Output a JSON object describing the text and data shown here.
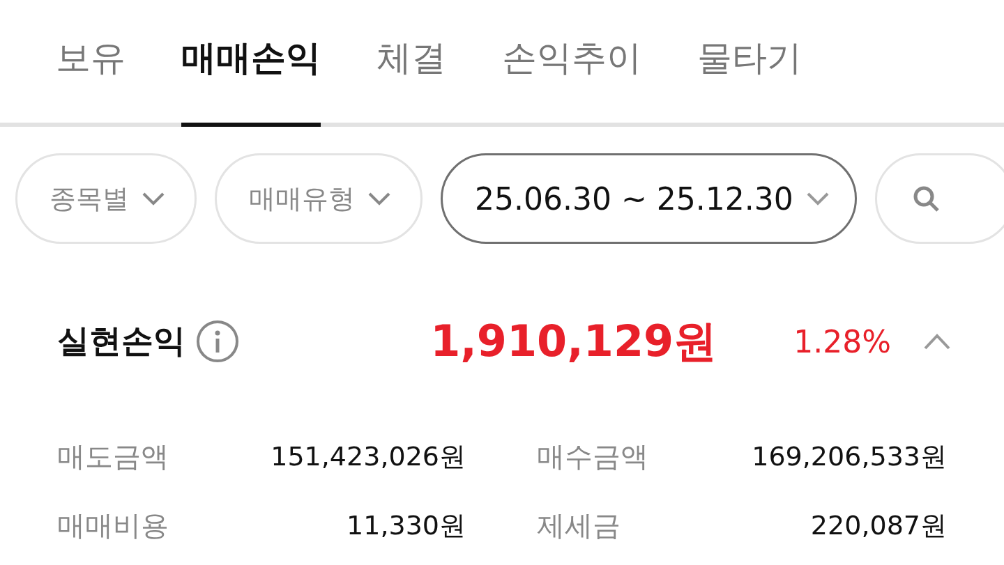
{
  "tabs": [
    {
      "label": "보유",
      "selected": false
    },
    {
      "label": "매매손익",
      "selected": true
    },
    {
      "label": "체결",
      "selected": false
    },
    {
      "label": "손익추이",
      "selected": false
    },
    {
      "label": "물타기",
      "selected": false
    }
  ],
  "filters": [
    {
      "kind": "dropdown",
      "label": "종목별",
      "active": false
    },
    {
      "kind": "dropdown",
      "label": "매매유형",
      "active": false
    },
    {
      "kind": "dropdown",
      "label": "25.06.30 ~ 25.12.30",
      "active": true
    },
    {
      "kind": "search",
      "active": false
    }
  ],
  "summary": {
    "label": "실현손익",
    "amount": "1,910,129원",
    "rate": "1.28%",
    "expanded": true
  },
  "details": [
    {
      "label": "매도금액",
      "value": "151,423,026원"
    },
    {
      "label": "매수금액",
      "value": "169,206,533원"
    },
    {
      "label": "매매비용",
      "value": "11,330원"
    },
    {
      "label": "제세금",
      "value": "220,087원"
    }
  ]
}
